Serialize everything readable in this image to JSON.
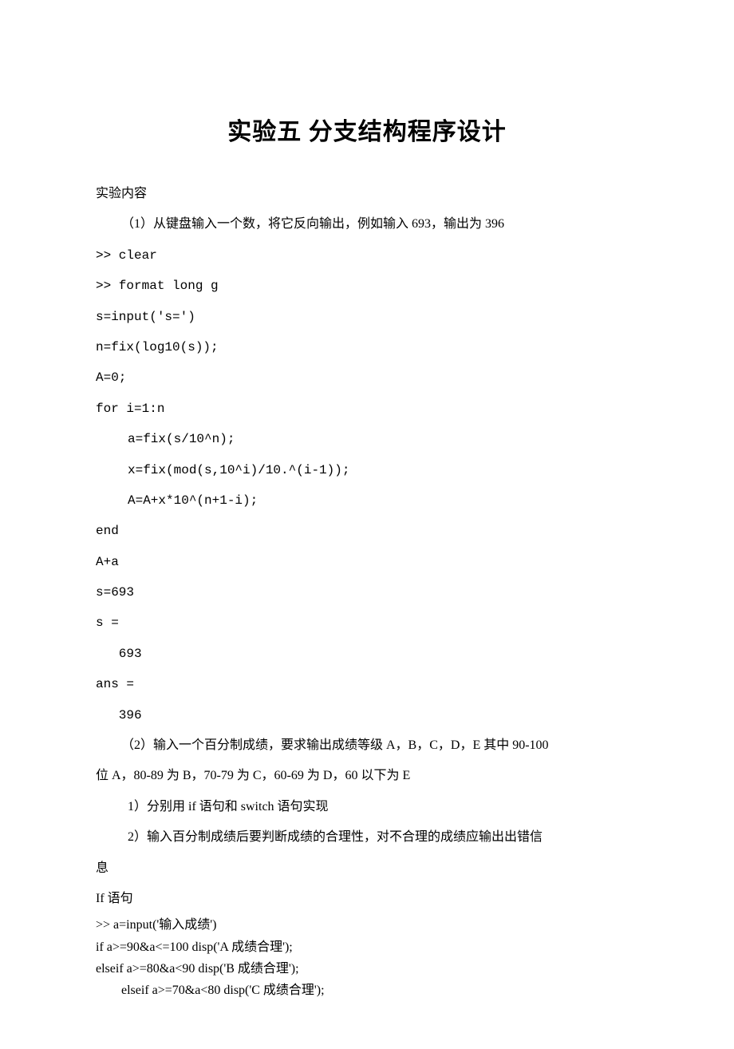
{
  "title": "实验五  分支结构程序设计",
  "section_label": "实验内容",
  "q1": {
    "prompt": "（1）从键盘输入一个数，将它反向输出，例如输入 693，输出为 396",
    "code": {
      "l1": ">> clear",
      "l2": ">> format long g",
      "l3": "s=input('s=')",
      "l4": "n=fix(log10(s));",
      "l5": "A=0;",
      "l6": "for i=1:n",
      "l7": "a=fix(s/10^n);",
      "l8": "x=fix(mod(s,10^i)/10.^(i-1));",
      "l9": "A=A+x*10^(n+1-i);",
      "l10": "end",
      "l11": "A+a",
      "out1": "s=693",
      "out2": "s =",
      "out3": "693",
      "out4": "ans =",
      "out5": "396"
    }
  },
  "q2": {
    "prompt_l1": "（2）输入一个百分制成绩，要求输出成绩等级 A，B，C，D，E 其中 90-100",
    "prompt_l2": "位 A，80-89 为 B，70-79 为 C，60-69 为 D，60 以下为 E",
    "sub1": "1）分别用 if 语句和 switch 语句实现",
    "sub2": "2）输入百分制成绩后要判断成绩的合理性，对不合理的成绩应输出出错信",
    "sub2b": "息",
    "if_label": "If 语句",
    "code": {
      "l1": ">> a=input('输入成绩')",
      "l2": "if a>=90&a<=100 disp('A  成绩合理');",
      "l3": "elseif a>=80&a<90 disp('B  成绩合理');",
      "l4": "elseif a>=70&a<80 disp('C  成绩合理');"
    }
  }
}
